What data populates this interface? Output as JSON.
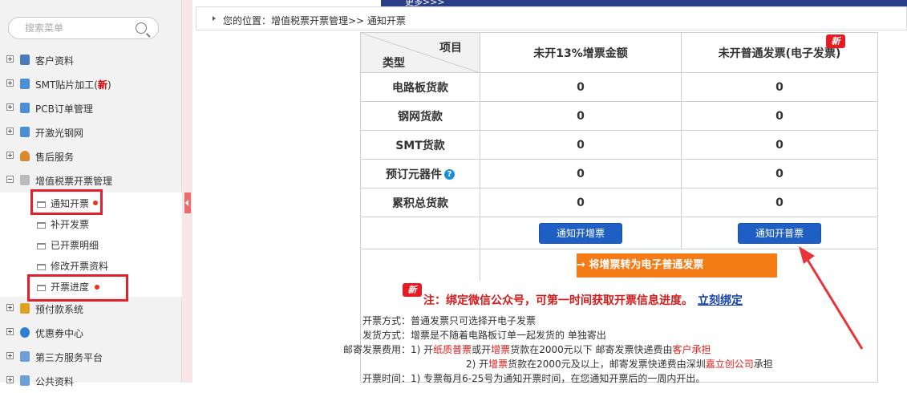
{
  "banner": {
    "more": "更多>>>"
  },
  "sidebar": {
    "search_placeholder": "搜索菜单",
    "items": [
      {
        "label": "客户资料",
        "icon": "user-card-icon",
        "color": "#4a7bbd"
      },
      {
        "label": "SMT贴片加工(",
        "badge": "新",
        "badge_suffix": ")",
        "icon": "chip-icon",
        "color": "#4a8fd8"
      },
      {
        "label": "PCB订单管理",
        "icon": "board-icon",
        "color": "#4a8fd8"
      },
      {
        "label": "开激光钢网",
        "icon": "grid-icon",
        "color": "#4a8fd8"
      },
      {
        "label": "售后服务",
        "icon": "person-icon",
        "color": "#d98b2b"
      },
      {
        "label": "增值税票开票管理",
        "icon": "document-icon",
        "color": "#8a8a8a"
      },
      {
        "label": "预付款系统",
        "icon": "coins-icon",
        "color": "#e0a020"
      },
      {
        "label": "优惠券中心",
        "icon": "shield-icon",
        "color": "#2f7fd0"
      },
      {
        "label": "第三方服务平台",
        "icon": "window-icon",
        "color": "#6a9fd8"
      },
      {
        "label": "公共资料",
        "icon": "window-icon",
        "color": "#6a9fd8"
      }
    ],
    "sub_items": [
      {
        "label": "通知开票"
      },
      {
        "label": "补开发票"
      },
      {
        "label": "已开票明细"
      },
      {
        "label": "修改开票资料"
      },
      {
        "label": "开票进度"
      }
    ]
  },
  "breadcrumb": "您的位置：增值税票开票管理>> 通知开票",
  "table": {
    "corner_top": "项目",
    "corner_bottom": "类型",
    "col1": "未开13%增票金额",
    "col2": "未开普通发票(电子发票)",
    "new_badge": "新",
    "rows": [
      {
        "label": "电路板货款",
        "v1": "0",
        "v2": "0"
      },
      {
        "label": "钢网货款",
        "v1": "0",
        "v2": "0"
      },
      {
        "label": "SMT货款",
        "v1": "0",
        "v2": "0"
      },
      {
        "label": "预订元器件",
        "v1": "0",
        "v2": "0",
        "help": "?"
      },
      {
        "label": "累积总货款",
        "v1": "0",
        "v2": "0"
      }
    ],
    "btn_vat": "通知开增票",
    "btn_normal": "通知开普票",
    "btn_convert": "→ 将增票转为电子普通发票"
  },
  "info": {
    "new_badge": "新",
    "notice": "注：绑定微信公众号，可第一时间获取开票信息进度。",
    "bind_link": "立刻绑定",
    "l1k": "开票方式：",
    "l1v": "普通发票只可选择开电子发票",
    "l2k": "发货方式：",
    "l2v": "增票是不随着电路板订单一起发货的 单独寄出",
    "l3k": "邮寄发票费用：",
    "l3a": "1) 开",
    "l3b": "纸质普票",
    "l3c": "或开",
    "l3d": "增票",
    "l3e": "货款在2000元以下 邮寄发票快递费由",
    "l3f": "客户承担",
    "l4a": "2) 开",
    "l4b": "增票",
    "l4c": "货款在2000元及以上，邮寄发票快递费由深圳",
    "l4d": "嘉立创公司",
    "l4e": "承担",
    "l5k": "开票时间：",
    "l5v": "1) 专票每月6-25号为通知开票时间，在您通知开票后的一周内开出。"
  },
  "colors": {
    "highlight": "#e0222f",
    "arrow": "#e8333a",
    "button_blue": "#1f5fc3",
    "button_orange": "#f47b16"
  }
}
